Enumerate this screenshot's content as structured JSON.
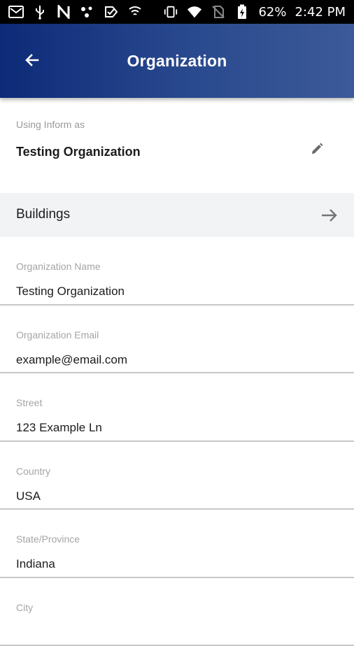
{
  "status_bar": {
    "battery": "62%",
    "time": "2:42 PM",
    "icons": [
      "gmail-icon",
      "usb-icon",
      "n-icon",
      "dots-icon",
      "check-icon",
      "hotspot-icon",
      "vibrate-icon",
      "wifi-icon",
      "no-sim-icon",
      "battery-charging-icon"
    ]
  },
  "app_bar": {
    "title": "Organization",
    "back_icon": "arrow-left-icon",
    "background_colors": [
      "#0d2a78",
      "#3c5a98"
    ]
  },
  "using_as": {
    "label": "Using Inform as",
    "value": "Testing Organization",
    "edit_icon": "pencil-icon"
  },
  "buildings": {
    "label": "Buildings",
    "icon": "arrow-right-icon"
  },
  "fields": [
    {
      "label": "Organization Name",
      "value": "Testing Organization"
    },
    {
      "label": "Organization Email",
      "value": "example@email.com"
    },
    {
      "label": "Street",
      "value": "123 Example Ln"
    },
    {
      "label": "Country",
      "value": "USA"
    },
    {
      "label": "State/Province",
      "value": "Indiana"
    },
    {
      "label": "City",
      "value": ""
    }
  ]
}
